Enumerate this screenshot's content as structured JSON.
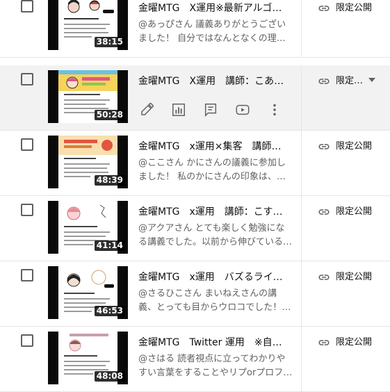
{
  "rows": [
    {
      "title": "金曜MTG　X運用※最新アルゴリズム…",
      "description": "@あっぴさん 議義ありがとうございました！ 自分ではなんとなくの理解になって…",
      "duration": "38:15",
      "visibility": "限定公開",
      "thumb_colors": {
        "banner": "#ffffff",
        "accent": "#111111"
      }
    },
    {
      "title": "金曜MTG　X運用　講師：こあたんさ…",
      "description": "",
      "duration": "50:28",
      "visibility": "限定…",
      "thumb_colors": {
        "banner": "#f3c94a",
        "accent": "#e0558a"
      }
    },
    {
      "title": "金曜MTG　x運用×集客　講師：かに…",
      "description": "@ここさん かにさんの議義に参加しました！ 私のかにさんの印象は、フォロワー…",
      "duration": "48:39",
      "visibility": "限定公開",
      "thumb_colors": {
        "banner": "#f7d49a",
        "accent": "#e2553f"
      }
    },
    {
      "title": "金曜MTG　x運用　講師：こすちゃ…",
      "description": "@アクアさん とても楽しく勉強になる講義でした。以前から伸びているアカウン…",
      "duration": "41:14",
      "visibility": "限定公開",
      "thumb_colors": {
        "banner": "#ffffff",
        "accent": "#e88a9a"
      }
    },
    {
      "title": "金曜MTG　x運用　バズるライティン…",
      "description": "@さるひこさん まいねえさんの講義、とっても目からウロコでした！ 学生のころ…",
      "duration": "46:53",
      "visibility": "限定公開",
      "thumb_colors": {
        "banner": "#ffffff",
        "accent": "#c9a06a"
      }
    },
    {
      "title": "金曜MTG　Twitter 運用　※自己開示…",
      "description": "@さはる 読者視点に立ってわかりやすい言葉をすることやリプorプロフ誘導の使…",
      "duration": "48:08",
      "visibility": "限定公開",
      "thumb_colors": {
        "banner": "#ffffff",
        "accent": "#d08a9a"
      }
    }
  ],
  "hover_actions": [
    "edit-icon",
    "analytics-icon",
    "comments-icon",
    "youtube-play-icon",
    "more-options-icon"
  ],
  "colors": {
    "hover_row": "#f2f2f2",
    "divider": "#e5e5e5",
    "secondary_text": "#606060"
  }
}
